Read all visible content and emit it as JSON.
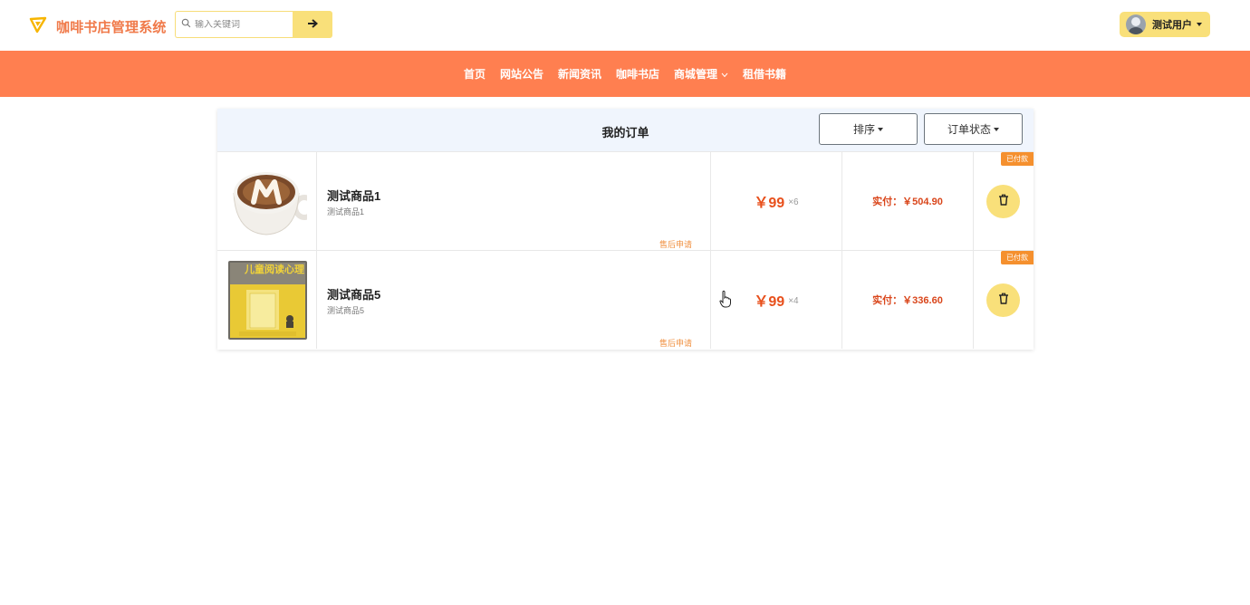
{
  "header": {
    "app_title": "咖啡书店管理系统",
    "search_placeholder": "输入关键词",
    "user_name": "测试用户"
  },
  "nav": [
    {
      "label": "首页"
    },
    {
      "label": "网站公告"
    },
    {
      "label": "新闻资讯"
    },
    {
      "label": "咖啡书店"
    },
    {
      "label": "商城管理",
      "has_dropdown": true
    },
    {
      "label": "租借书籍"
    }
  ],
  "orders": {
    "title": "我的订单",
    "sort_label": "排序",
    "status_label": "订单状态",
    "items": [
      {
        "image": "coffee-cup-image",
        "name": "测试商品1",
        "desc": "测试商品1",
        "after_sale": "售后申请",
        "price": "￥99",
        "qty": "×6",
        "paid_label": "实付：",
        "paid_value": "￥504.90",
        "status": "已付款"
      },
      {
        "image": "book-cover-image",
        "name": "测试商品5",
        "desc": "测试商品5",
        "after_sale": "售后申请",
        "price": "￥99",
        "qty": "×4",
        "paid_label": "实付：",
        "paid_value": "￥336.60",
        "status": "已付款"
      }
    ]
  },
  "book_cover_text": "儿童阅读心理",
  "colors": {
    "nav_bg": "#ff7f50",
    "accent_yellow": "#f9e07a",
    "price_red": "#e8501c",
    "badge_orange": "#f5902e"
  }
}
